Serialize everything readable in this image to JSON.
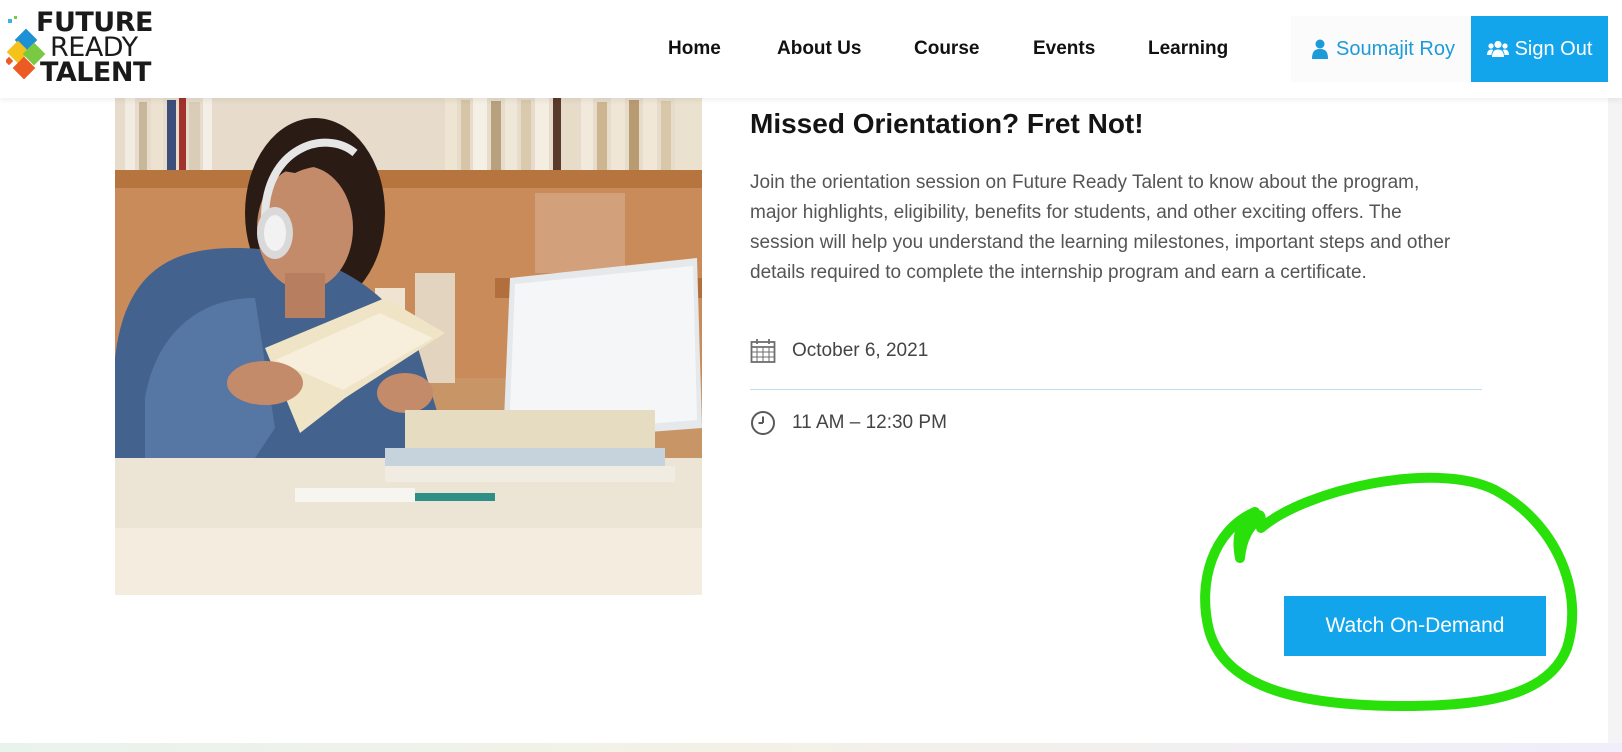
{
  "logo": {
    "line1": "FUTURE",
    "line2": "READY",
    "line3": "TALENT"
  },
  "nav": {
    "items": [
      "Home",
      "About Us",
      "Course",
      "Events",
      "Learning"
    ]
  },
  "user": {
    "name": "Soumajit Roy",
    "icon": "user-icon"
  },
  "signout": {
    "label": "Sign Out",
    "icon": "users-icon"
  },
  "event": {
    "title": "Missed Orientation? Fret Not!",
    "description": "Join the orientation session on Future Ready Talent to know about the program, major highlights, eligibility, benefits for students, and other exciting offers. The session will help you understand the learning milestones, important steps and other details required to complete the internship program and earn a certificate.",
    "date": "October 6, 2021",
    "time": "11 AM – 12:30 PM",
    "cta_label": "Watch On-Demand"
  },
  "colors": {
    "accent": "#12a5eb",
    "user_link": "#1d9bd8",
    "annotation": "#29e00a"
  }
}
